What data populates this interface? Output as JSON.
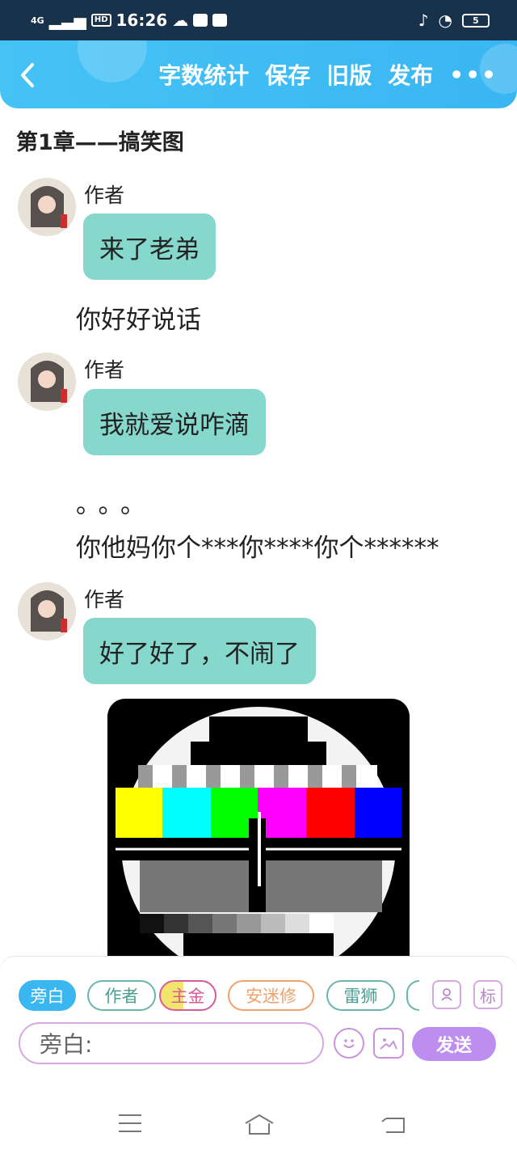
{
  "status_bar": {
    "network": "4G",
    "hd": "HD",
    "time": "16:26",
    "battery": "5"
  },
  "header": {
    "actions": [
      "字数统计",
      "保存",
      "旧版",
      "发布"
    ],
    "more_label": "•••"
  },
  "chapter": {
    "title": "第1章——搞笑图"
  },
  "messages": [
    {
      "author": "作者",
      "text": "来了老弟"
    },
    {
      "narration": "你好好说话"
    },
    {
      "author": "作者",
      "text": "我就爱说咋滴"
    },
    {
      "narration": "。。。"
    },
    {
      "narration": "你他妈你个***你****你个******"
    },
    {
      "author": "作者",
      "text": "好了好了，不闹了"
    }
  ],
  "roles": [
    {
      "label": "旁白",
      "active": true
    },
    {
      "label": "作者",
      "active": false
    },
    {
      "label": "主金",
      "active": false
    },
    {
      "label": "安迷修",
      "active": false
    },
    {
      "label": "雷狮",
      "active": false
    }
  ],
  "role_tools": {
    "tag_label": "标"
  },
  "composer": {
    "input_label": "旁白:",
    "send_label": "发送"
  },
  "colors": {
    "header": "#3ab6f2",
    "bubble": "#86d7cc",
    "send": "#bd8ef0",
    "status_bar": "#17324a"
  }
}
